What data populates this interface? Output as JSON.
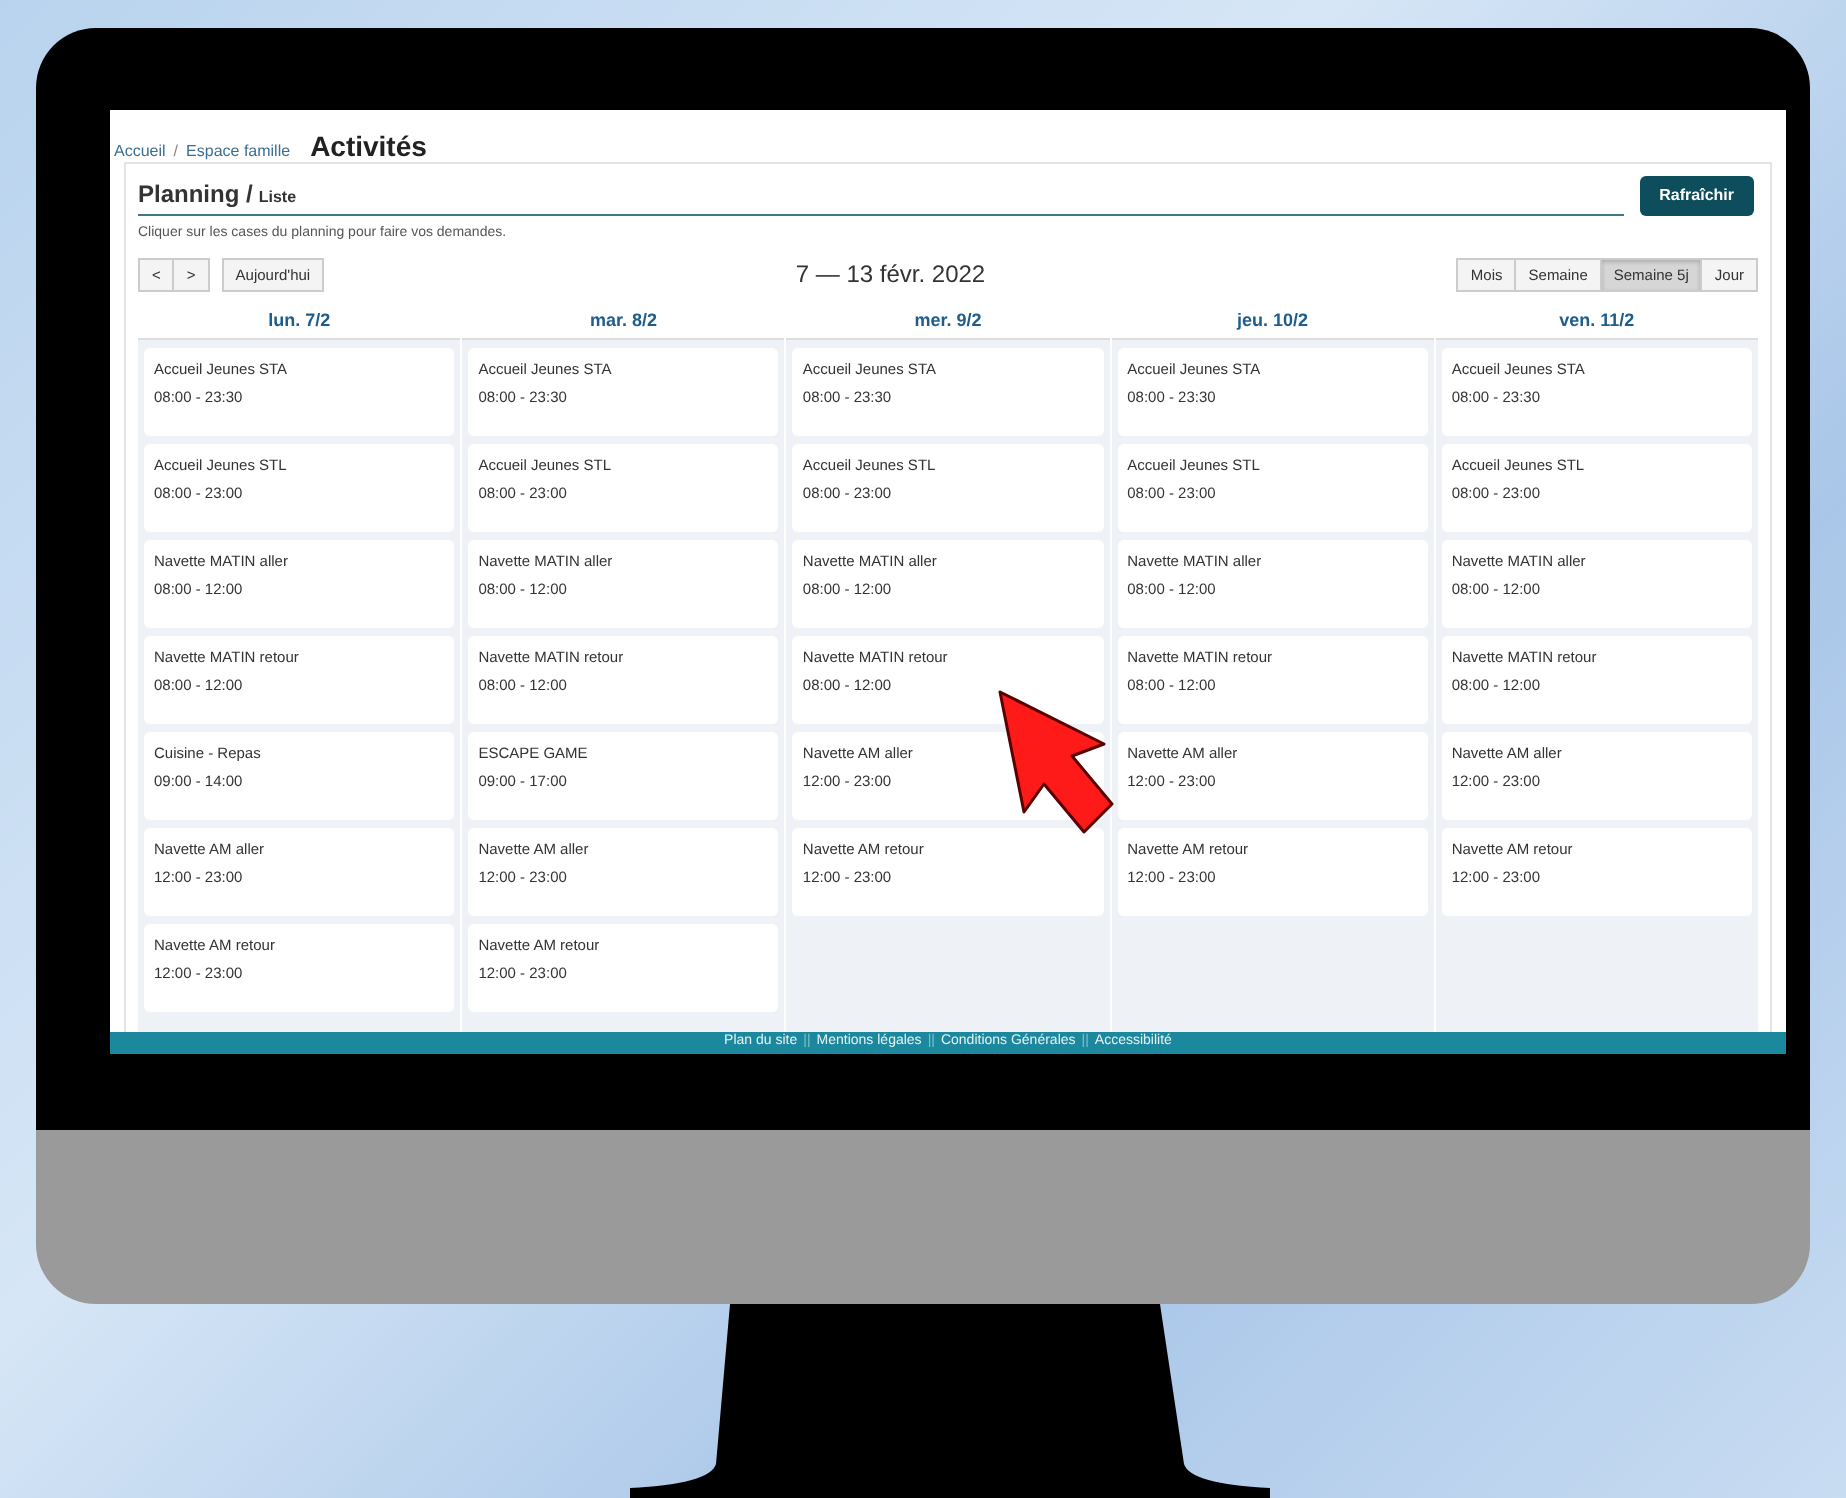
{
  "breadcrumb": {
    "items": [
      "Accueil",
      "Espace famille"
    ],
    "separator": "/",
    "page_title": "Activités"
  },
  "panel": {
    "title": "Planning",
    "separator": "/",
    "subtitle": "Liste",
    "refresh_button": "Rafraîchir",
    "instruction": "Cliquer sur les cases du planning pour faire vos demandes."
  },
  "toolbar": {
    "prev": "<",
    "next": ">",
    "today": "Aujourd'hui",
    "range": "7 — 13 févr. 2022",
    "views": [
      {
        "label": "Mois",
        "selected": false
      },
      {
        "label": "Semaine",
        "selected": false
      },
      {
        "label": "Semaine 5j",
        "selected": true
      },
      {
        "label": "Jour",
        "selected": false
      }
    ]
  },
  "days": [
    {
      "label": "lun. 7/2",
      "events": [
        {
          "title": "Accueil Jeunes STA",
          "time": "08:00 - 23:30"
        },
        {
          "title": "Accueil Jeunes STL",
          "time": "08:00 - 23:00"
        },
        {
          "title": "Navette MATIN aller",
          "time": "08:00 - 12:00"
        },
        {
          "title": "Navette MATIN retour",
          "time": "08:00 - 12:00"
        },
        {
          "title": "Cuisine - Repas",
          "time": "09:00 - 14:00"
        },
        {
          "title": "Navette AM aller",
          "time": "12:00 - 23:00"
        },
        {
          "title": "Navette AM retour",
          "time": "12:00 - 23:00"
        }
      ]
    },
    {
      "label": "mar. 8/2",
      "events": [
        {
          "title": "Accueil Jeunes STA",
          "time": "08:00 - 23:30"
        },
        {
          "title": "Accueil Jeunes STL",
          "time": "08:00 - 23:00"
        },
        {
          "title": "Navette MATIN aller",
          "time": "08:00 - 12:00"
        },
        {
          "title": "Navette MATIN retour",
          "time": "08:00 - 12:00"
        },
        {
          "title": "ESCAPE GAME",
          "time": "09:00 - 17:00"
        },
        {
          "title": "Navette AM aller",
          "time": "12:00 - 23:00"
        },
        {
          "title": "Navette AM retour",
          "time": "12:00 - 23:00"
        }
      ]
    },
    {
      "label": "mer. 9/2",
      "events": [
        {
          "title": "Accueil Jeunes STA",
          "time": "08:00 - 23:30"
        },
        {
          "title": "Accueil Jeunes STL",
          "time": "08:00 - 23:00"
        },
        {
          "title": "Navette MATIN aller",
          "time": "08:00 - 12:00"
        },
        {
          "title": "Navette MATIN retour",
          "time": "08:00 - 12:00"
        },
        {
          "title": "Navette AM aller",
          "time": "12:00 - 23:00"
        },
        {
          "title": "Navette AM retour",
          "time": "12:00 - 23:00"
        }
      ]
    },
    {
      "label": "jeu. 10/2",
      "events": [
        {
          "title": "Accueil Jeunes STA",
          "time": "08:00 - 23:30"
        },
        {
          "title": "Accueil Jeunes STL",
          "time": "08:00 - 23:00"
        },
        {
          "title": "Navette MATIN aller",
          "time": "08:00 - 12:00"
        },
        {
          "title": "Navette MATIN retour",
          "time": "08:00 - 12:00"
        },
        {
          "title": "Navette AM aller",
          "time": "12:00 - 23:00"
        },
        {
          "title": "Navette AM retour",
          "time": "12:00 - 23:00"
        }
      ]
    },
    {
      "label": "ven. 11/2",
      "events": [
        {
          "title": "Accueil Jeunes STA",
          "time": "08:00 - 23:30"
        },
        {
          "title": "Accueil Jeunes STL",
          "time": "08:00 - 23:00"
        },
        {
          "title": "Navette MATIN aller",
          "time": "08:00 - 12:00"
        },
        {
          "title": "Navette MATIN retour",
          "time": "08:00 - 12:00"
        },
        {
          "title": "Navette AM aller",
          "time": "12:00 - 23:00"
        },
        {
          "title": "Navette AM retour",
          "time": "12:00 - 23:00"
        }
      ]
    }
  ],
  "footer": {
    "links": [
      "Plan du site",
      "Mentions légales",
      "Conditions Générales",
      "Accessibilité"
    ],
    "separator": "||"
  }
}
